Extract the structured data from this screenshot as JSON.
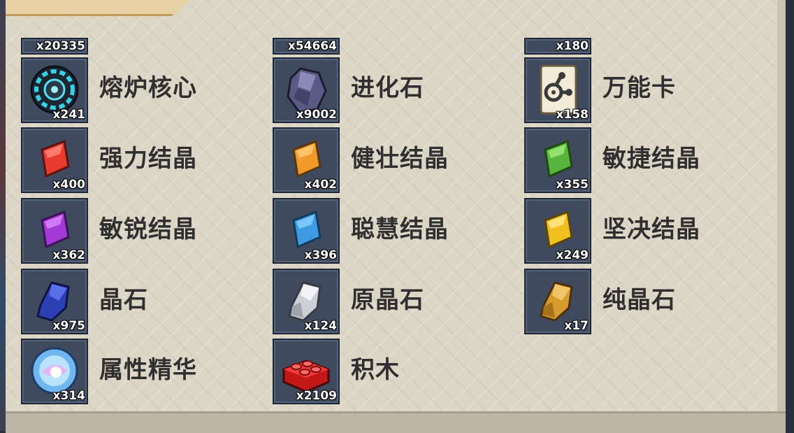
{
  "partial_counts": [
    "x20335",
    "x54664",
    "x180"
  ],
  "items": [
    {
      "name": "熔炉核心",
      "count": "x241",
      "icon": "furnace-core-icon"
    },
    {
      "name": "进化石",
      "count": "x9002",
      "icon": "evolution-stone-icon"
    },
    {
      "name": "万能卡",
      "count": "x158",
      "icon": "universal-card-icon"
    },
    {
      "name": "强力结晶",
      "count": "x400",
      "icon": "red-crystal-icon",
      "color": "#e63b2e"
    },
    {
      "name": "健壮结晶",
      "count": "x402",
      "icon": "orange-crystal-icon",
      "color": "#ef9a2a"
    },
    {
      "name": "敏捷结晶",
      "count": "x355",
      "icon": "green-crystal-icon",
      "color": "#57b43c"
    },
    {
      "name": "敏锐结晶",
      "count": "x362",
      "icon": "purple-crystal-icon",
      "color": "#a43ad6"
    },
    {
      "name": "聪慧结晶",
      "count": "x396",
      "icon": "blue-crystal-icon",
      "color": "#3d9ae3"
    },
    {
      "name": "坚决结晶",
      "count": "x249",
      "icon": "yellow-crystal-icon",
      "color": "#f0c021"
    },
    {
      "name": "晶石",
      "count": "x975",
      "icon": "spar-icon",
      "color": "#2d3fb5"
    },
    {
      "name": "原晶石",
      "count": "x124",
      "icon": "raw-spar-icon",
      "color": "#cfcfd6"
    },
    {
      "name": "纯晶石",
      "count": "x17",
      "icon": "pure-spar-icon",
      "color": "#d69a2d"
    },
    {
      "name": "属性精华",
      "count": "x314",
      "icon": "attribute-essence-icon"
    },
    {
      "name": "积木",
      "count": "x2109",
      "icon": "building-block-icon",
      "color": "#e02828"
    }
  ]
}
